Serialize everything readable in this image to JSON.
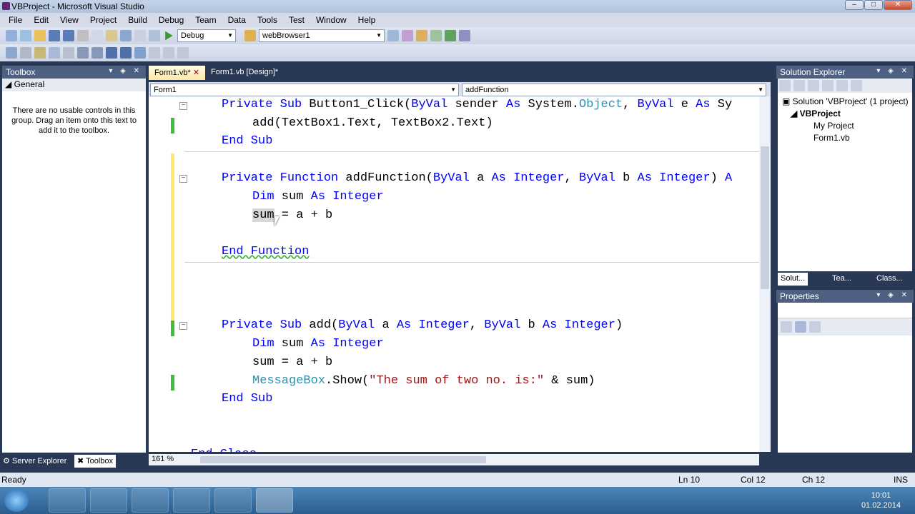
{
  "window": {
    "title": "VBProject - Microsoft Visual Studio"
  },
  "menu": [
    "File",
    "Edit",
    "View",
    "Project",
    "Build",
    "Debug",
    "Team",
    "Data",
    "Tools",
    "Test",
    "Window",
    "Help"
  ],
  "toolbar": {
    "config": "Debug",
    "target": "webBrowser1"
  },
  "toolbox": {
    "title": "Toolbox",
    "group": "General",
    "message": "There are no usable controls in this group. Drag an item onto this text to add it to the toolbox."
  },
  "tabs": [
    {
      "label": "Form1.vb*"
    },
    {
      "label": "Form1.vb [Design]*"
    }
  ],
  "navbar": {
    "left": "Form1",
    "right": "addFunction"
  },
  "code": {
    "l1": [
      "Private",
      "Sub",
      "Button1_Click(",
      "ByVal",
      "sender",
      "As",
      "System.",
      "Object",
      ",",
      "ByVal",
      "e",
      "As",
      "Sy"
    ],
    "line1": "    Private Sub Button1_Click(ByVal sender As System.Object, ByVal e As Sy",
    "line2": "        add(TextBox1.Text, TextBox2.Text)",
    "line3": "    End Sub",
    "line4": "    Private Function addFunction(ByVal a As Integer, ByVal b As Integer) A",
    "line5": "        Dim sum As Integer",
    "line6": "        sum = a + b",
    "line7": "    End Function",
    "line8": "    Private Sub add(ByVal a As Integer, ByVal b As Integer)",
    "line9": "        Dim sum As Integer",
    "line10": "        sum = a + b",
    "line11": "        MessageBox.Show(\"The sum of two no. is:\" & sum)",
    "line12": "    End Sub",
    "line13": "End Class"
  },
  "zoom": "161 %",
  "solution": {
    "title": "Solution Explorer",
    "root": "Solution 'VBProject' (1 project)",
    "project": "VBProject",
    "items": [
      "My Project",
      "Form1.vb"
    ],
    "tabs": [
      "Solut...",
      "Tea...",
      "Class..."
    ]
  },
  "properties": {
    "title": "Properties"
  },
  "bottomtabs": [
    "Server Explorer",
    "Toolbox"
  ],
  "status": {
    "left": "Ready",
    "ln": "Ln 10",
    "col": "Col 12",
    "ch": "Ch 12",
    "mode": "INS"
  },
  "clock": {
    "time": "10:01",
    "date": "01.02.2014"
  },
  "colors": {
    "keyword": "#0000ff",
    "type": "#2b91af",
    "string": "#a31515",
    "chrome": "#293955"
  }
}
